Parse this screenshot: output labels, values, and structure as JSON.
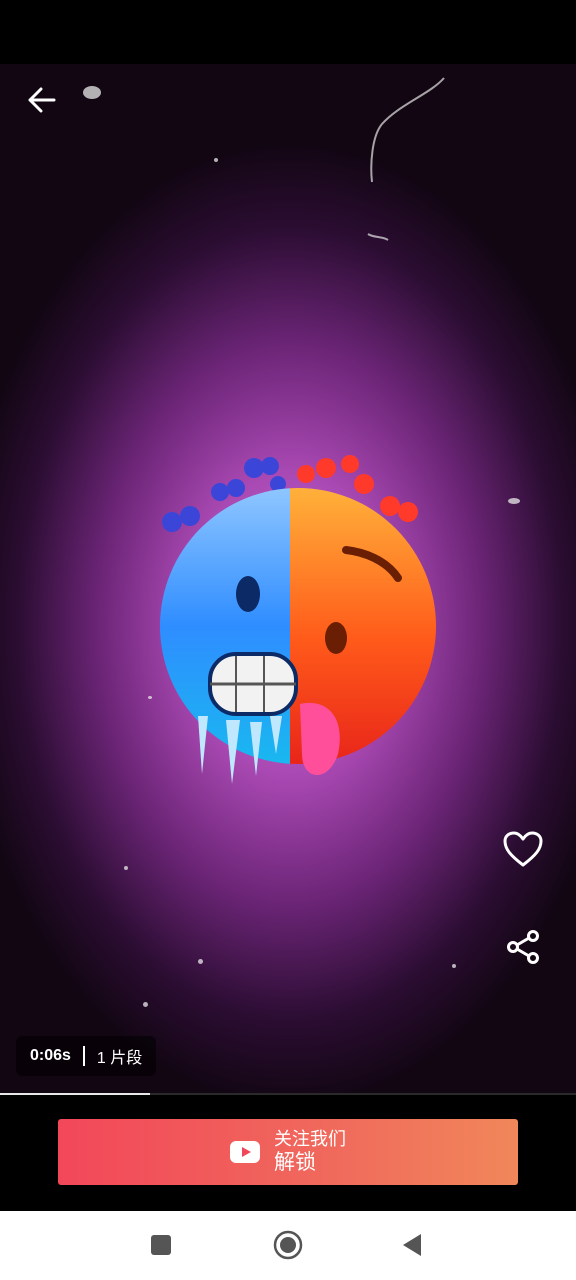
{
  "player": {
    "duration": "0:06s",
    "segments": "1 片段",
    "progress_fraction": 0.26
  },
  "cta": {
    "line1": "关注我们",
    "line2": "解锁"
  },
  "icons": {
    "back": "arrow-left-icon",
    "like": "heart-outline-icon",
    "share": "share-icon",
    "cta": "youtube-play-icon",
    "nav_recents": "square-icon",
    "nav_home": "circle-icon",
    "nav_back": "triangle-back-icon"
  },
  "colors": {
    "cta_gradient_start": "#f2475a",
    "cta_gradient_end": "#f1875a",
    "video_glow": "#d070d8",
    "nav_icon": "#555555"
  }
}
